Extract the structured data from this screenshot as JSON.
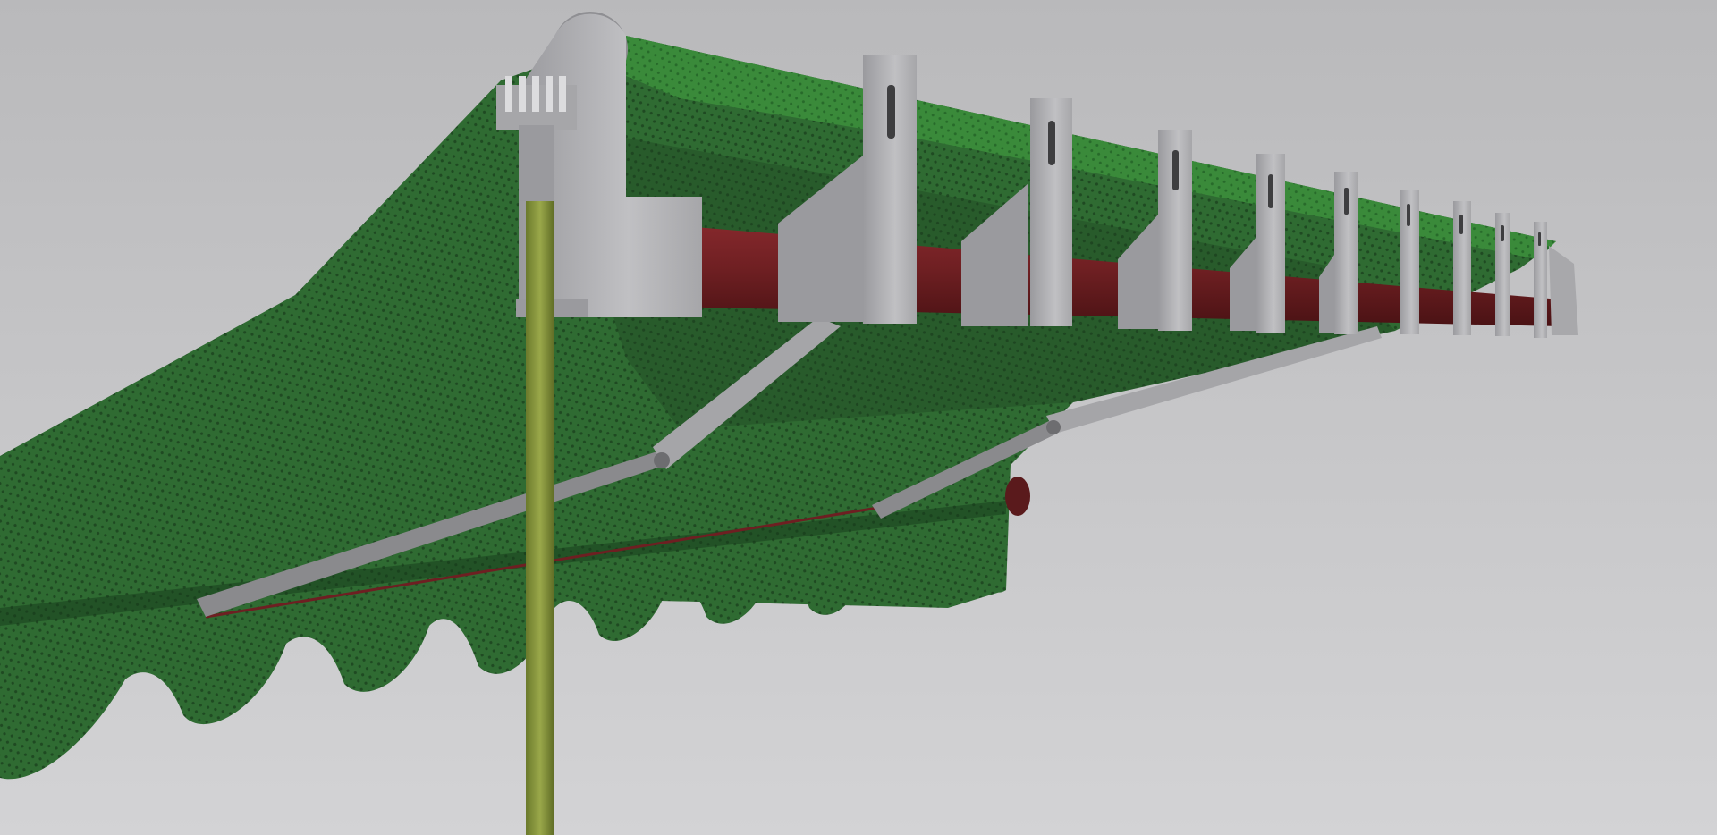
{
  "scene": {
    "subject": "retractable-awning-render",
    "bracket_count": 10,
    "colors": {
      "background_top": "#b9b9bb",
      "background_bottom": "#d2d2d4",
      "fabric": "#2f6b32",
      "fabric_light": "#3f8f3b",
      "fabric_dark": "#1f4d22",
      "tube": "#6e1f22",
      "tube_dark": "#4a1214",
      "bracket": "#b3b3b6",
      "bracket_shade": "#8f8f93",
      "arm": "#8a8a8d",
      "crank_pole": "#7d8f35"
    }
  }
}
